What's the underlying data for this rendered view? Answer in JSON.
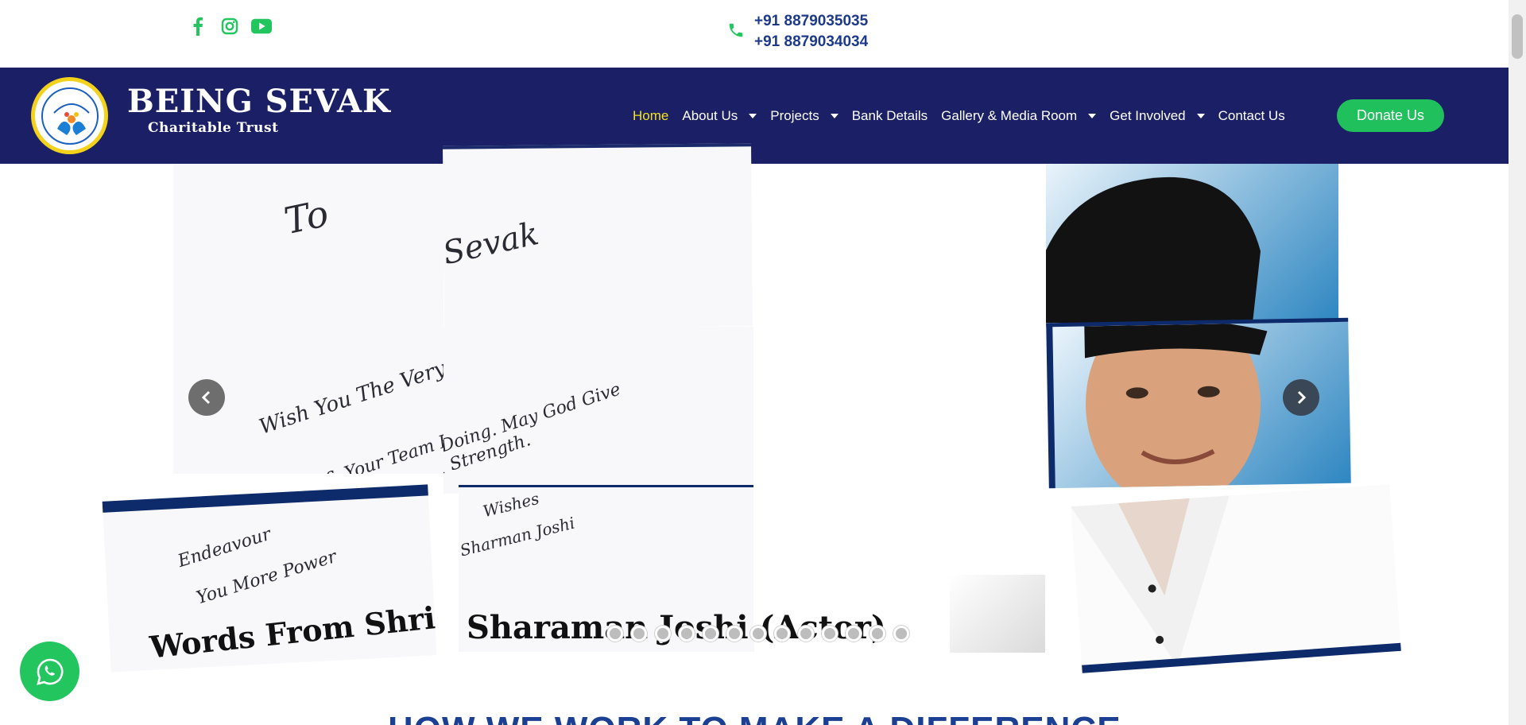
{
  "topbar": {
    "social": [
      "facebook-icon",
      "instagram-icon",
      "youtube-icon"
    ],
    "phones": [
      "+91 8879035035",
      "+91 8879034034"
    ]
  },
  "brand": {
    "name": "BEING SEVAK",
    "subtitle": "Charitable Trust",
    "logo_text_top": "Being Sevak"
  },
  "nav": {
    "items": [
      {
        "label": "Home",
        "active": true,
        "dropdown": false
      },
      {
        "label": "About Us",
        "active": false,
        "dropdown": true
      },
      {
        "label": "Projects",
        "active": false,
        "dropdown": true
      },
      {
        "label": "Bank Details",
        "active": false,
        "dropdown": false
      },
      {
        "label": "Gallery & Media Room",
        "active": false,
        "dropdown": true
      },
      {
        "label": "Get Involved",
        "active": false,
        "dropdown": true
      },
      {
        "label": "Contact Us",
        "active": false,
        "dropdown": false
      }
    ],
    "donate_label": "Donate Us"
  },
  "slider": {
    "letter_lines": [
      "To",
      "Being Sevak",
      "Wish You The Very Best And",
      "Salute You & Your Team For The Wonderful",
      "You'll Are Doing. May God Give",
      "& Strength.",
      "Endeavour",
      "You More Power",
      "Wishes",
      "Sharman Joshi"
    ],
    "caption_left": "Words From Shri.",
    "caption_center": "Sharaman Joshi (Actor)",
    "dot_count": 13,
    "active_dot": 0
  },
  "section": {
    "heading": "HOW WE WORK TO MAKE A DIFFERENCE"
  },
  "colors": {
    "nav_bg": "#1b1f66",
    "accent_green": "#20c05c",
    "active_link": "#f2e31b",
    "phone_text": "#1d3a8a"
  }
}
